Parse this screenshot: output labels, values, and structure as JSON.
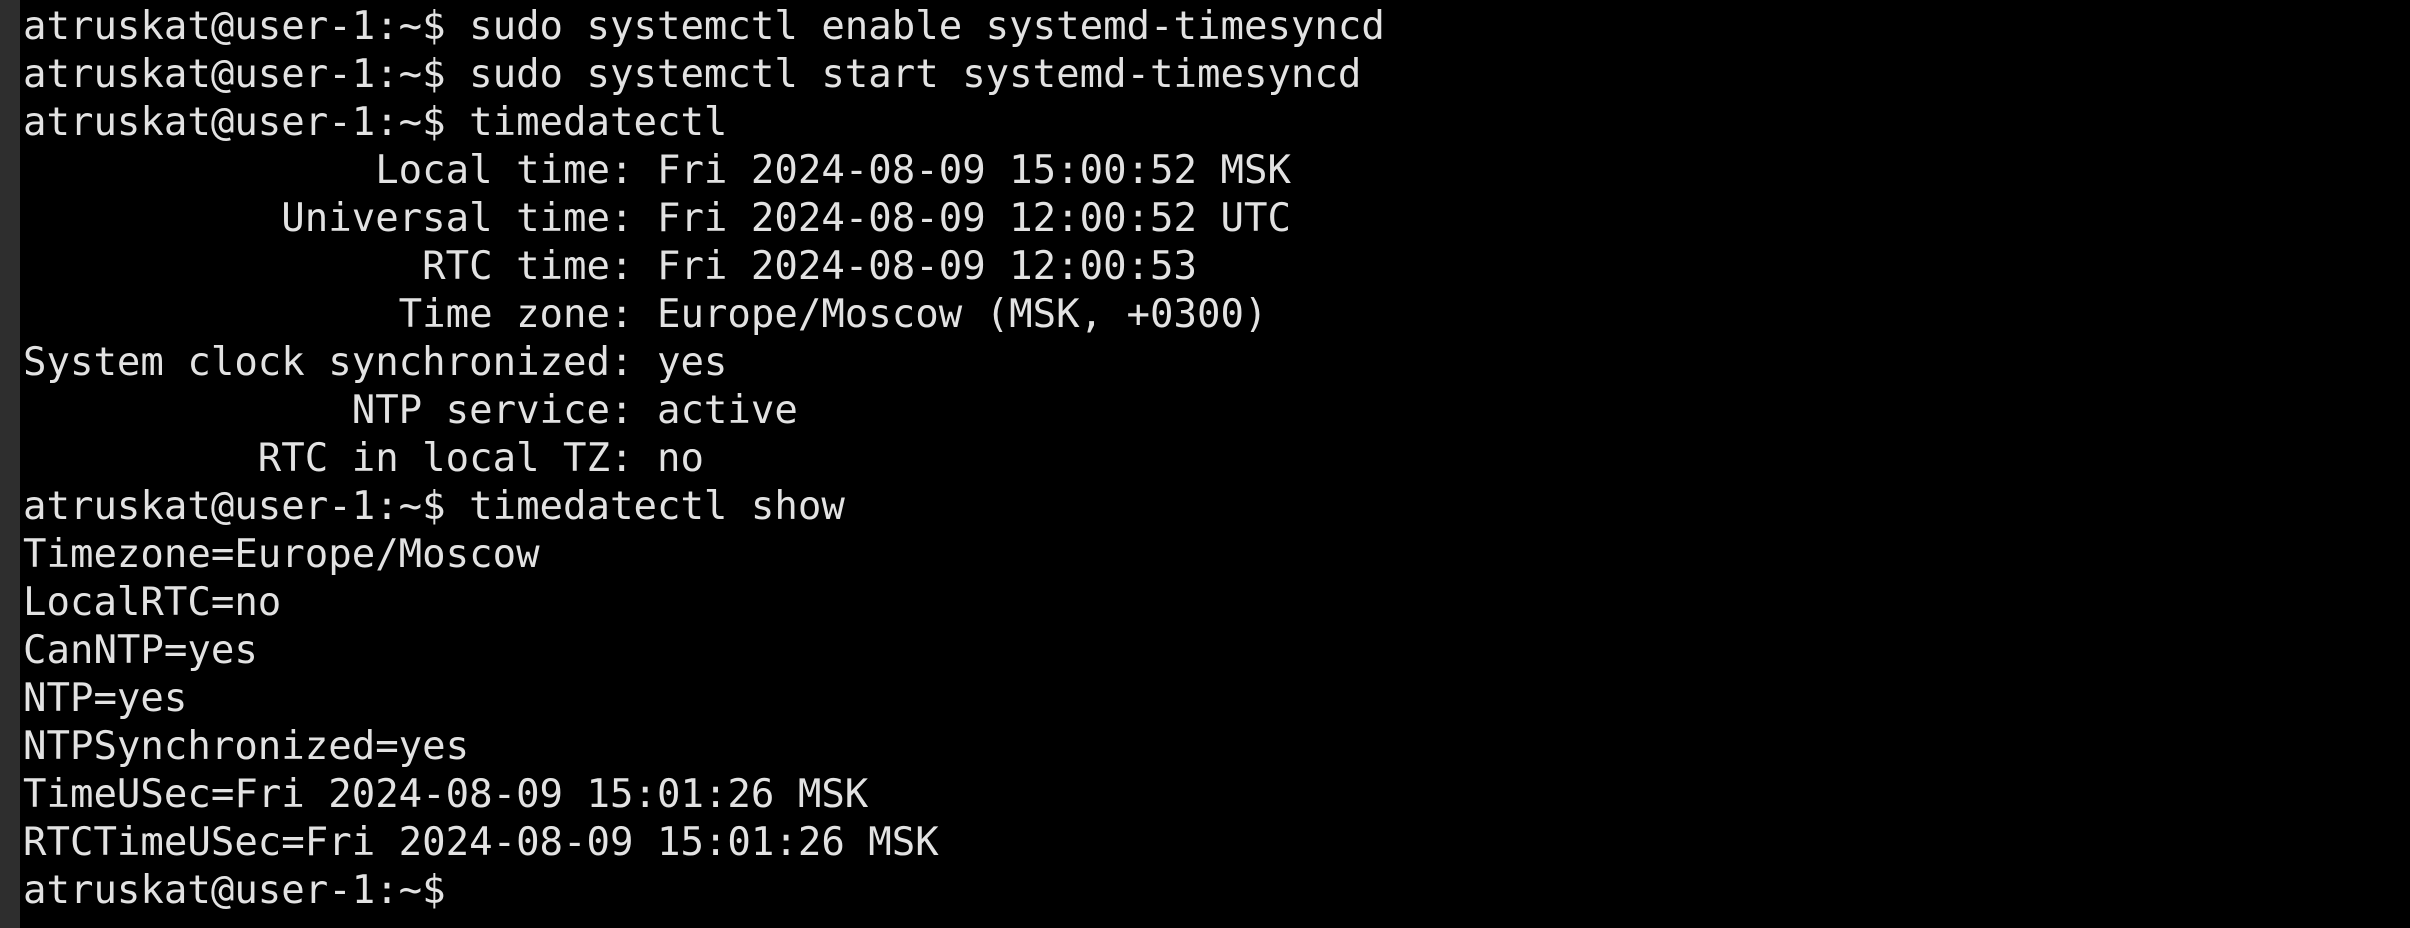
{
  "terminal": {
    "lines": [
      "atruskat@user-1:~$ sudo systemctl enable systemd-timesyncd",
      "atruskat@user-1:~$ sudo systemctl start systemd-timesyncd",
      "atruskat@user-1:~$ timedatectl",
      "               Local time: Fri 2024-08-09 15:00:52 MSK",
      "           Universal time: Fri 2024-08-09 12:00:52 UTC",
      "                 RTC time: Fri 2024-08-09 12:00:53",
      "                Time zone: Europe/Moscow (MSK, +0300)",
      "System clock synchronized: yes",
      "              NTP service: active",
      "          RTC in local TZ: no",
      "atruskat@user-1:~$ timedatectl show",
      "Timezone=Europe/Moscow",
      "LocalRTC=no",
      "CanNTP=yes",
      "NTP=yes",
      "NTPSynchronized=yes",
      "TimeUSec=Fri 2024-08-09 15:01:26 MSK",
      "RTCTimeUSec=Fri 2024-08-09 15:01:26 MSK",
      "atruskat@user-1:~$"
    ]
  },
  "colors": {
    "background": "#000000",
    "text": "#e2e2e2",
    "left_strip": "#2e2e2e"
  }
}
